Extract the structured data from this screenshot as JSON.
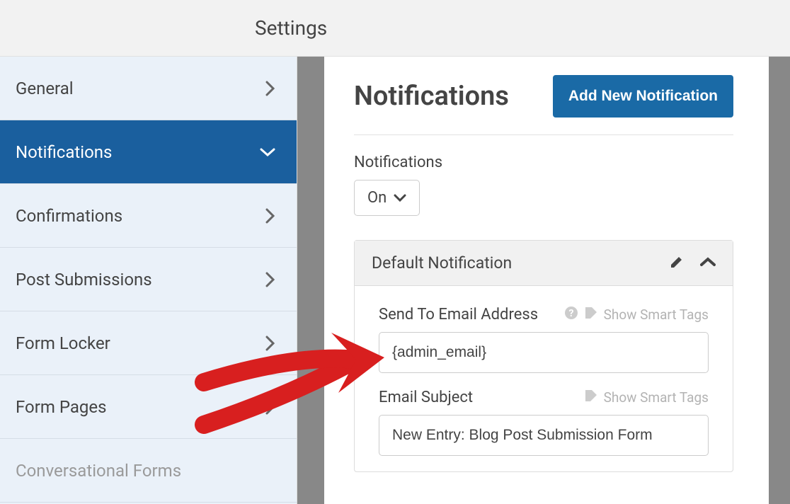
{
  "topbar": {
    "title": "Settings"
  },
  "sidebar": {
    "items": [
      {
        "label": "General"
      },
      {
        "label": "Notifications"
      },
      {
        "label": "Confirmations"
      },
      {
        "label": "Post Submissions"
      },
      {
        "label": "Form Locker"
      },
      {
        "label": "Form Pages"
      },
      {
        "label": "Conversational Forms"
      }
    ]
  },
  "page": {
    "title": "Notifications",
    "add_btn": "Add New Notification",
    "notif_label": "Notifications",
    "dropdown_value": "On"
  },
  "panel": {
    "title": "Default Notification",
    "fields": {
      "send_to_label": "Send To Email Address",
      "send_to_value": "{admin_email}",
      "smart_tags": "Show Smart Tags",
      "subject_label": "Email Subject",
      "subject_value": "New Entry: Blog Post Submission Form"
    }
  }
}
